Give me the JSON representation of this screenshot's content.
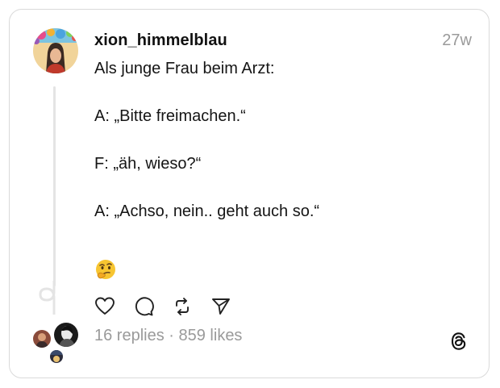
{
  "post": {
    "username": "xion_himmelblau",
    "timestamp": "27w",
    "lines": [
      "Als junge Frau beim Arzt:",
      "",
      "A: „Bitte freimachen.“",
      "",
      "F: „äh, wieso?“",
      "",
      "A: „Achso, nein.. geht auch so.“"
    ],
    "emoji": "🤔",
    "emoji_icon": "thinking-face-icon"
  },
  "actions": [
    {
      "name": "like-button",
      "icon": "heart-icon"
    },
    {
      "name": "reply-button",
      "icon": "comment-icon"
    },
    {
      "name": "repost-button",
      "icon": "repost-icon"
    },
    {
      "name": "share-button",
      "icon": "send-icon"
    }
  ],
  "stats": {
    "replies": "16 replies",
    "separator": " · ",
    "likes": "859 likes"
  },
  "brand": {
    "logo": "threads-logo-icon"
  },
  "colors": {
    "text": "#151515",
    "muted": "#9a9a9a",
    "border": "#dadada",
    "thread_line": "#e4e4e4"
  }
}
